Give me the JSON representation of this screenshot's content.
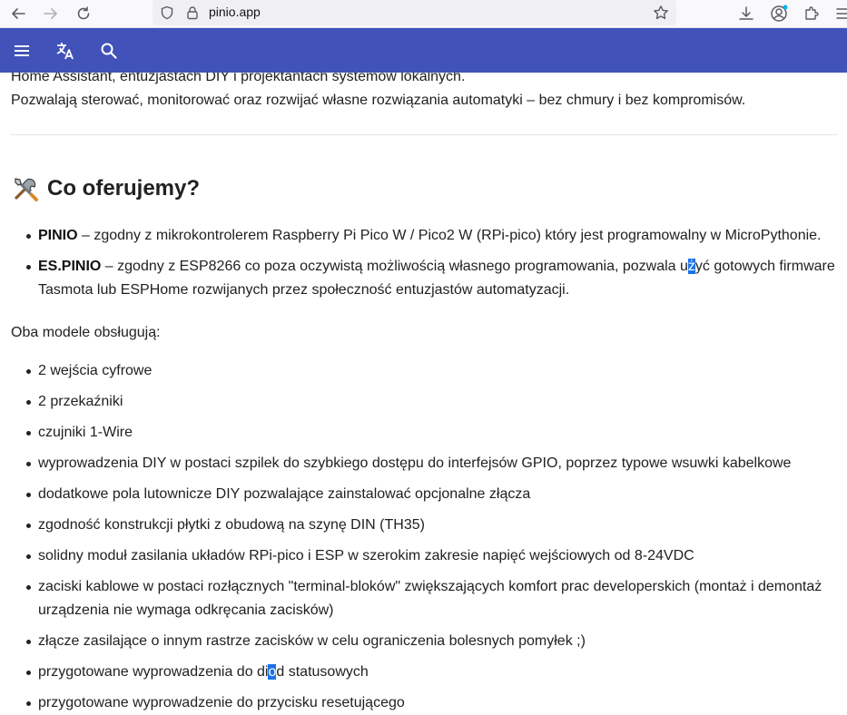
{
  "browser": {
    "url": "pinio.app",
    "icons": [
      "back-arrow-icon",
      "forward-arrow-icon",
      "reload-icon",
      "shield-icon",
      "lock-icon",
      "star-icon",
      "download-icon",
      "account-icon",
      "extensions-icon",
      "menu-icon"
    ]
  },
  "appbar": {
    "icons": [
      "hamburger-menu-icon",
      "translate-icon",
      "search-icon"
    ],
    "color": "#4152b8"
  },
  "intro": {
    "line1": "Home Assistant, entuzjastach DIY i projektantach systemów lokalnych.",
    "line2": "Pozwalają sterować, monitorować oraz rozwijać własne rozwiązania automatyki – bez chmury i bez kompromisów."
  },
  "section": {
    "emoji": "tools-emoji-icon",
    "title": "Co oferujemy?"
  },
  "offers": [
    {
      "name": "PINIO",
      "text": " – zgodny z mikrokontrolerem Raspberry Pi Pico W / Pico2 W (RPi-pico) który jest programowalny w MicroPythonie."
    },
    {
      "name": "ES.PINIO",
      "text_before": " – zgodny z ESP8266 co poza oczywistą możliwością własnego programowania, pozwala u",
      "text_selected": "ż",
      "text_after": "yć gotowych firmware Tasmota lub ESPHome rozwijanych przez społeczność entuzjastów automatyzacji."
    }
  ],
  "features_intro": "Oba modele obsługują:",
  "features": [
    "2 wejścia cyfrowe",
    "2 przekaźniki",
    "czujniki 1-Wire",
    "wyprowadzenia DIY w postaci szpilek do szybkiego dostępu do interfejsów GPIO, poprzez typowe wsuwki kabelkowe",
    "dodatkowe pola lutownicze DIY pozwalające zainstalować opcjonalne złącza",
    "zgodność konstrukcji płytki z obudową na szynę DIN (TH35)",
    "solidny moduł zasilania układów RPi-pico i ESP w szerokim zakresie napięć wejściowych od 8-24VDC",
    "zaciski kablowe w postaci rozłącznych \"terminal-bloków\" zwiększających komfort prac developerskich (montaż i demontaż urządzenia nie wymaga odkręcania zacisków)",
    "złącze zasilające o innym rastrze zacisków w celu ograniczenia bolesnych pomyłek ;)"
  ],
  "feature_diod": {
    "before": "przygotowane wyprowadzenia do di",
    "selected": "o",
    "after": "d statusowych"
  },
  "feature_last": "przygotowane wyprowadzenie do przycisku resetującego"
}
